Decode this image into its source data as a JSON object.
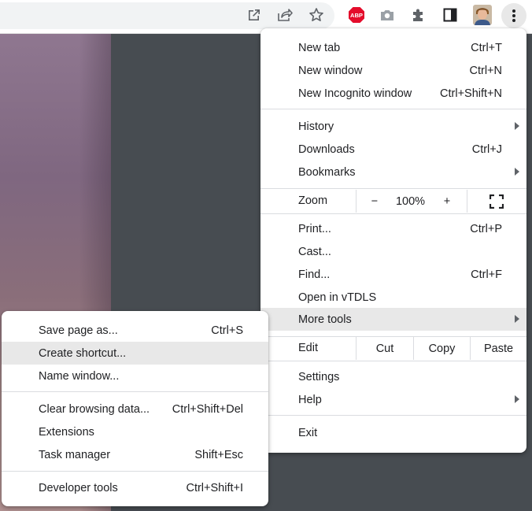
{
  "toolbar": {
    "icons": [
      "open-in-new-icon",
      "share-icon",
      "bookmark-star-icon",
      "adblock-plus-icon",
      "camera-icon",
      "puzzle-extensions-icon",
      "side-panel-icon",
      "profile-avatar",
      "kebab-menu-icon"
    ],
    "abp_text": "ABP",
    "accent": "#e40c2b"
  },
  "main_menu": {
    "new_tab": {
      "label": "New tab",
      "shortcut": "Ctrl+T"
    },
    "new_window": {
      "label": "New window",
      "shortcut": "Ctrl+N"
    },
    "new_incognito": {
      "label": "New Incognito window",
      "shortcut": "Ctrl+Shift+N"
    },
    "history": {
      "label": "History"
    },
    "downloads": {
      "label": "Downloads",
      "shortcut": "Ctrl+J"
    },
    "bookmarks": {
      "label": "Bookmarks"
    },
    "zoom": {
      "label": "Zoom",
      "minus": "−",
      "value": "100%",
      "plus": "+"
    },
    "print": {
      "label": "Print...",
      "shortcut": "Ctrl+P"
    },
    "cast": {
      "label": "Cast..."
    },
    "find": {
      "label": "Find...",
      "shortcut": "Ctrl+F"
    },
    "open_in": {
      "label": "Open in vTDLS"
    },
    "more_tools": {
      "label": "More tools"
    },
    "edit": {
      "label": "Edit",
      "cut": "Cut",
      "copy": "Copy",
      "paste": "Paste"
    },
    "settings": {
      "label": "Settings"
    },
    "help": {
      "label": "Help"
    },
    "exit": {
      "label": "Exit"
    }
  },
  "sub_menu": {
    "save_page": {
      "label": "Save page as...",
      "shortcut": "Ctrl+S"
    },
    "create_shortcut": {
      "label": "Create shortcut..."
    },
    "name_window": {
      "label": "Name window..."
    },
    "clear_browsing": {
      "label": "Clear browsing data...",
      "shortcut": "Ctrl+Shift+Del"
    },
    "extensions": {
      "label": "Extensions"
    },
    "task_manager": {
      "label": "Task manager",
      "shortcut": "Shift+Esc"
    },
    "developer_tools": {
      "label": "Developer tools",
      "shortcut": "Ctrl+Shift+I"
    }
  }
}
